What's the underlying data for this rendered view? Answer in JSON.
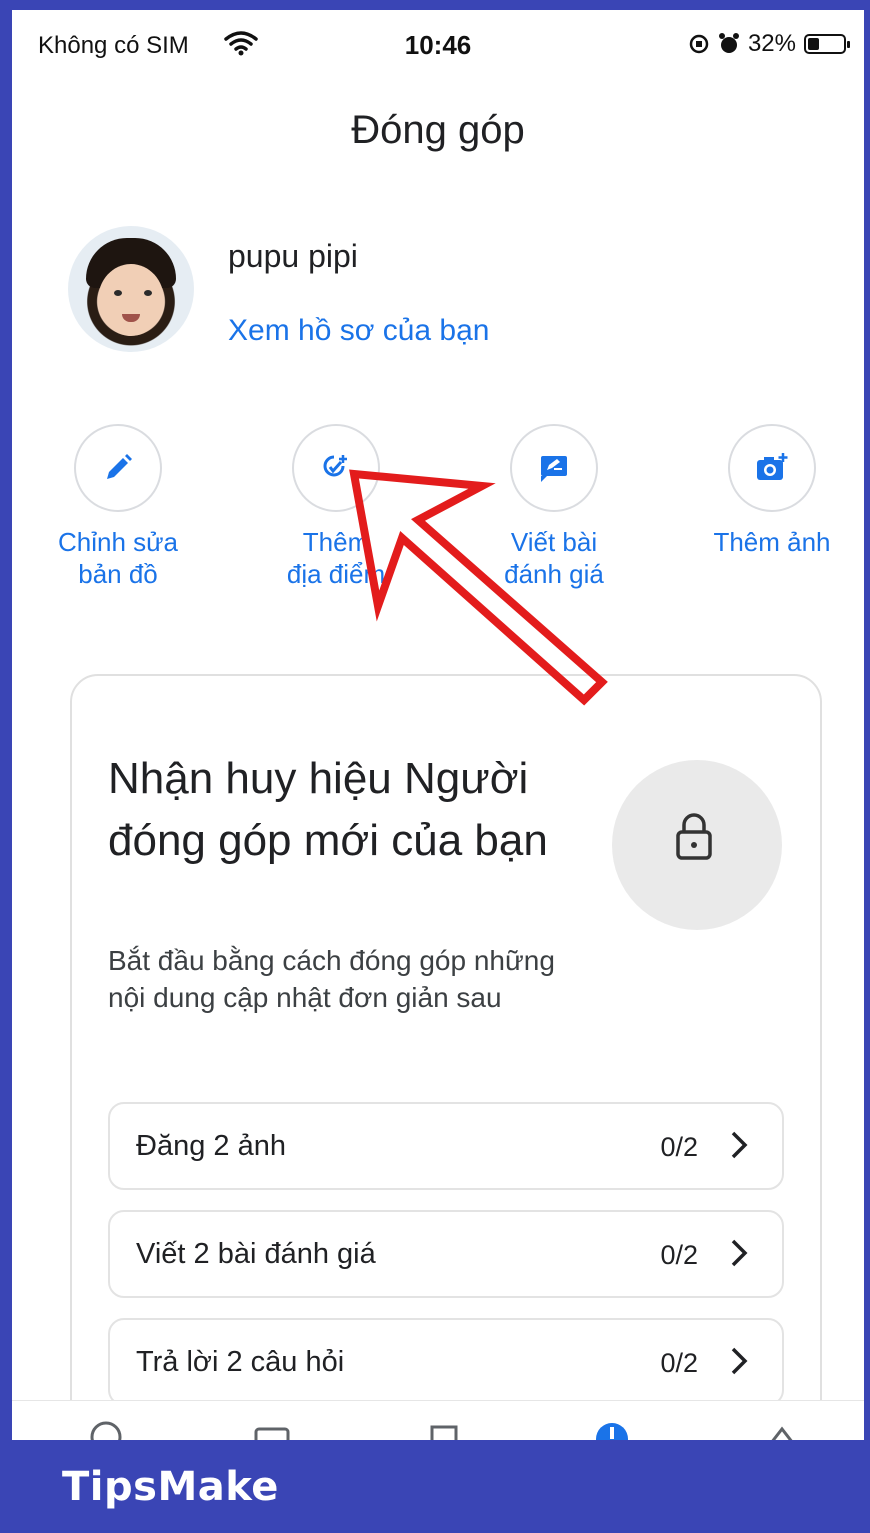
{
  "status_bar": {
    "carrier": "Không có SIM",
    "time": "10:46",
    "battery": "32%",
    "battery_level": 0.32
  },
  "header": {
    "title": "Đóng góp"
  },
  "profile": {
    "name": "pupu pipi",
    "link": "Xem hồ sơ của bạn"
  },
  "actions": [
    {
      "label": "Chỉnh sửa\nbản đồ",
      "icon": "pencil-icon"
    },
    {
      "label": "Thêm\nđịa điểm",
      "icon": "add-place-icon"
    },
    {
      "label": "Viết bài\nđánh giá",
      "icon": "review-icon"
    },
    {
      "label": "Thêm ảnh",
      "icon": "add-photo-icon"
    }
  ],
  "badge_card": {
    "title": "Nhận huy hiệu Người đóng góp mới của bạn",
    "subtitle": "Bắt đầu bằng cách đóng góp những nội dung cập nhật đơn giản sau",
    "tasks": [
      {
        "label": "Đăng 2 ảnh",
        "count": "0/2"
      },
      {
        "label": "Viết 2 bài đánh giá",
        "count": "0/2"
      },
      {
        "label": "Trả lời 2 câu hỏi",
        "count": "0/2"
      }
    ]
  },
  "brand": "TipsMake",
  "colors": {
    "accent": "#1a73e8",
    "frame": "#3a45b5",
    "arrow": "#e31c1c"
  }
}
